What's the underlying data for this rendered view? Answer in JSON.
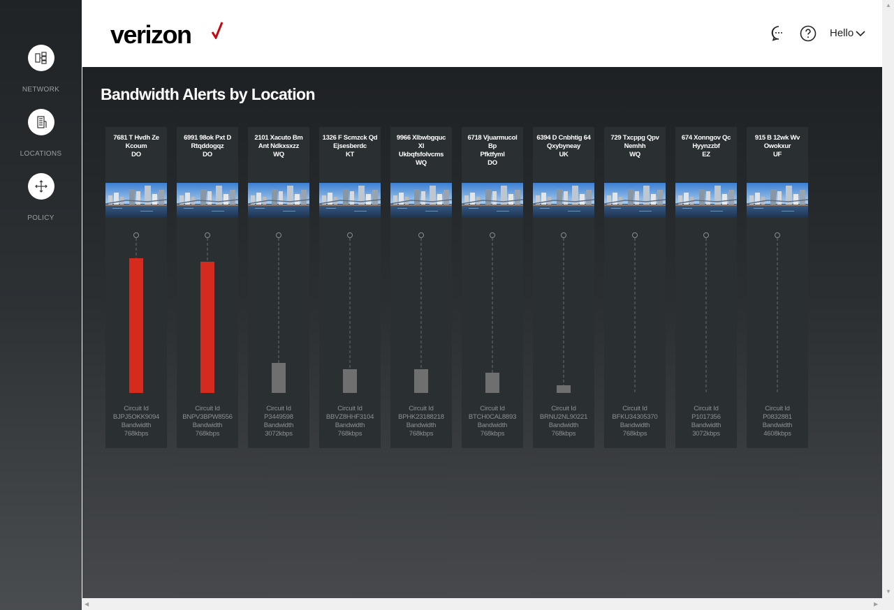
{
  "brand": {
    "logo_text": "verizon",
    "accent": "#cd040b"
  },
  "sidebar": {
    "items": [
      {
        "label": "NETWORK",
        "icon": "network-icon"
      },
      {
        "label": "LOCATIONS",
        "icon": "building-icon"
      },
      {
        "label": "POLICY",
        "icon": "move-arrows-icon"
      }
    ]
  },
  "header": {
    "chat_icon": "chat-bubble-icon",
    "help_icon": "help-circle-icon",
    "user_greeting": "Hello"
  },
  "main": {
    "title": "Bandwidth Alerts by Location",
    "colors": {
      "alert": "#d52b1e",
      "normal": "#6f6f6f"
    },
    "locations": [
      {
        "name_lines": [
          "7681 T Hvdh Ze",
          "Kcoum",
          "DO"
        ],
        "circuit_label": "Circuit Id",
        "circuit_id": "BJPJ5OKK9094",
        "bandwidth_label": "Bandwidth",
        "bandwidth": "768kbps",
        "usage_fraction": 0.86,
        "alert": true
      },
      {
        "name_lines": [
          "6991 98ok Pxt D",
          "Rtqddogqz",
          "DO"
        ],
        "circuit_label": "Circuit Id",
        "circuit_id": "BNPV3BPW8556",
        "bandwidth_label": "Bandwidth",
        "bandwidth": "768kbps",
        "usage_fraction": 0.84,
        "alert": true
      },
      {
        "name_lines": [
          "2101 Xacuto Bm",
          "Ant Ndkxsxzz",
          "WQ"
        ],
        "circuit_label": "Circuit Id",
        "circuit_id": "P3449598",
        "bandwidth_label": "Bandwidth",
        "bandwidth": "3072kbps",
        "usage_fraction": 0.19,
        "alert": false
      },
      {
        "name_lines": [
          "1326 F Scmzck Qd",
          "Ejsesberdc",
          "KT"
        ],
        "circuit_label": "Circuit Id",
        "circuit_id": "BBVZ8HHF3104",
        "bandwidth_label": "Bandwidth",
        "bandwidth": "768kbps",
        "usage_fraction": 0.15,
        "alert": false
      },
      {
        "name_lines": [
          "9966 Xlbwbgquc",
          "Xl",
          "Ukbqfsfolvcms",
          "WQ"
        ],
        "circuit_label": "Circuit Id",
        "circuit_id": "BPHK23188218",
        "bandwidth_label": "Bandwidth",
        "bandwidth": "768kbps",
        "usage_fraction": 0.15,
        "alert": false
      },
      {
        "name_lines": [
          "6718 Vjuarmucol",
          "Bp",
          "Pfktfyml",
          "DO"
        ],
        "circuit_label": "Circuit Id",
        "circuit_id": "BTCH0CAL8893",
        "bandwidth_label": "Bandwidth",
        "bandwidth": "768kbps",
        "usage_fraction": 0.13,
        "alert": false
      },
      {
        "name_lines": [
          "6394 D Cnbhtig 64",
          "Qxybyneay",
          "UK"
        ],
        "circuit_label": "Circuit Id",
        "circuit_id": "BRNU2NL90221",
        "bandwidth_label": "Bandwidth",
        "bandwidth": "768kbps",
        "usage_fraction": 0.05,
        "alert": false
      },
      {
        "name_lines": [
          "729 Txcppg Qpv",
          "Nemhh",
          "WQ"
        ],
        "circuit_label": "Circuit Id",
        "circuit_id": "BFKU34305370",
        "bandwidth_label": "Bandwidth",
        "bandwidth": "768kbps",
        "usage_fraction": 0.0,
        "alert": false
      },
      {
        "name_lines": [
          "674 Xonngov Qc",
          "Hyynzzbf",
          "EZ"
        ],
        "circuit_label": "Circuit Id",
        "circuit_id": "P1017356",
        "bandwidth_label": "Bandwidth",
        "bandwidth": "3072kbps",
        "usage_fraction": 0.0,
        "alert": false
      },
      {
        "name_lines": [
          "915 B 12wk Wv",
          "Owokxur",
          "UF"
        ],
        "circuit_label": "Circuit Id",
        "circuit_id": "P0832881",
        "bandwidth_label": "Bandwidth",
        "bandwidth": "4608kbps",
        "usage_fraction": 0.0,
        "alert": false
      }
    ]
  }
}
